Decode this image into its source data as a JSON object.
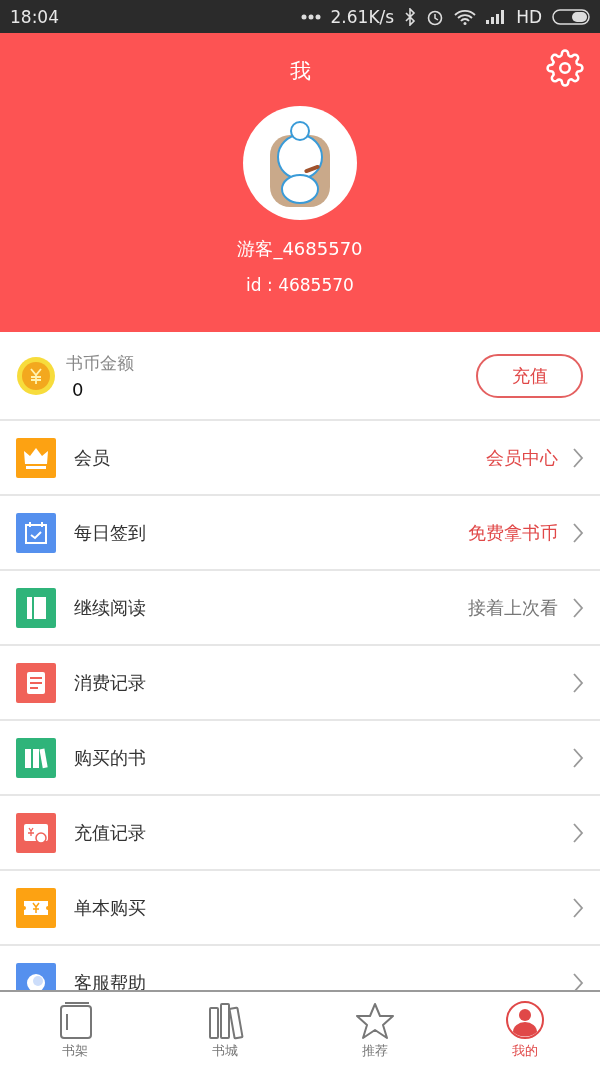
{
  "status_bar": {
    "time": "18:04",
    "speed": "2.61K/s",
    "network": "HD"
  },
  "header": {
    "title": "我",
    "username": "游客_4685570",
    "user_id": "id : 4685570"
  },
  "wallet": {
    "label": "书币金额",
    "balance": "0",
    "button": "充值"
  },
  "menu": [
    {
      "kind": "crown",
      "color": "#fda212",
      "label": "会员",
      "hint": "会员中心",
      "highlighted": true
    },
    {
      "kind": "calendar",
      "color": "#5590ee",
      "label": "每日签到",
      "hint": "免费拿书币",
      "highlighted": true
    },
    {
      "kind": "book",
      "color": "#2fb47a",
      "label": "继续阅读",
      "hint": "接着上次看",
      "highlighted": false
    },
    {
      "kind": "receipt",
      "color": "#f06259",
      "label": "消费记录"
    },
    {
      "kind": "books",
      "color": "#2fb47a",
      "label": "购买的书"
    },
    {
      "kind": "bill",
      "color": "#f06259",
      "label": "充值记录"
    },
    {
      "kind": "ticket",
      "color": "#fda212",
      "label": "单本购买"
    },
    {
      "kind": "help",
      "color": "#5590ee",
      "label": "客服帮助"
    }
  ],
  "tabs": [
    {
      "kind": "shelf",
      "label": "书架",
      "selected": false
    },
    {
      "kind": "store",
      "label": "书城",
      "selected": false
    },
    {
      "kind": "star",
      "label": "推荐",
      "selected": false
    },
    {
      "kind": "me",
      "label": "我的",
      "selected": true
    }
  ]
}
